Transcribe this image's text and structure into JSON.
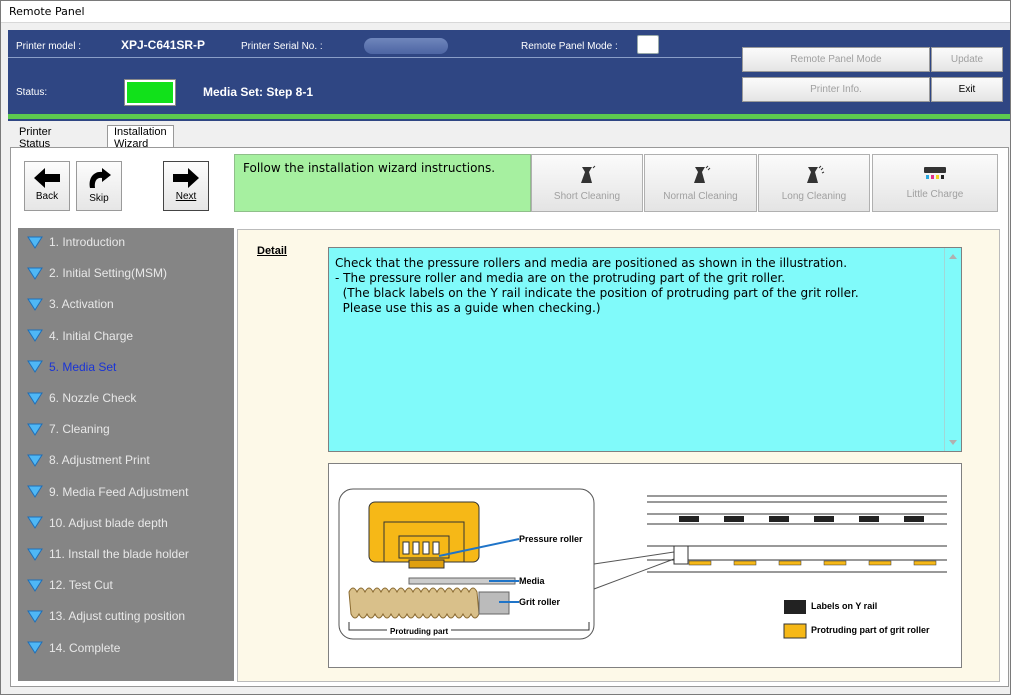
{
  "window": {
    "title": "Remote Panel"
  },
  "header": {
    "model_label": "Printer model :",
    "model_value": "XPJ-C641SR-P",
    "serial_label": "Printer Serial No. :",
    "mode_label": "Remote Panel Mode :",
    "status_label": "Status:",
    "status_text": "Media Set: Step 8-1",
    "status_color": "#11e11a",
    "buttons": {
      "remote_mode": "Remote Panel Mode",
      "update": "Update",
      "printer_info": "Printer Info.",
      "exit": "Exit"
    }
  },
  "tabs": [
    {
      "label": "Printer Status"
    },
    {
      "label": "Installation Wizard"
    }
  ],
  "toolbar": {
    "back": "Back",
    "skip": "Skip",
    "next": "Next",
    "message": "Follow the installation wizard instructions.",
    "short_cleaning": "Short Cleaning",
    "normal_cleaning": "Normal Cleaning",
    "long_cleaning": "Long Cleaning",
    "little_charge": "Little Charge"
  },
  "steps": [
    {
      "label": "1. Introduction"
    },
    {
      "label": "2. Initial Setting(MSM)"
    },
    {
      "label": "3. Activation"
    },
    {
      "label": "4. Initial Charge"
    },
    {
      "label": "5. Media Set"
    },
    {
      "label": "6. Nozzle Check"
    },
    {
      "label": "7. Cleaning"
    },
    {
      "label": "8. Adjustment Print"
    },
    {
      "label": "9. Media Feed Adjustment"
    },
    {
      "label": "10. Adjust blade depth"
    },
    {
      "label": "11. Install the blade holder"
    },
    {
      "label": "12. Test Cut"
    },
    {
      "label": "13. Adjust cutting position"
    },
    {
      "label": "14. Complete"
    }
  ],
  "active_step": 5,
  "detail": {
    "label": "Detail",
    "lines": [
      "Check that the pressure rollers and media are positioned as shown in the illustration.",
      "",
      "- The pressure roller and media are on the protruding part of the grit roller.",
      "  (The black labels on the Y rail indicate the position of protruding part of the grit roller.",
      "  Please use this as a guide when checking.)"
    ]
  },
  "illustration": {
    "pressure_roller": "Pressure roller",
    "media": "Media",
    "grit_roller": "Grit roller",
    "protruding_part": "Protruding part",
    "legend_labels": "Labels on Y rail",
    "legend_protruding": "Protruding part of grit roller"
  }
}
